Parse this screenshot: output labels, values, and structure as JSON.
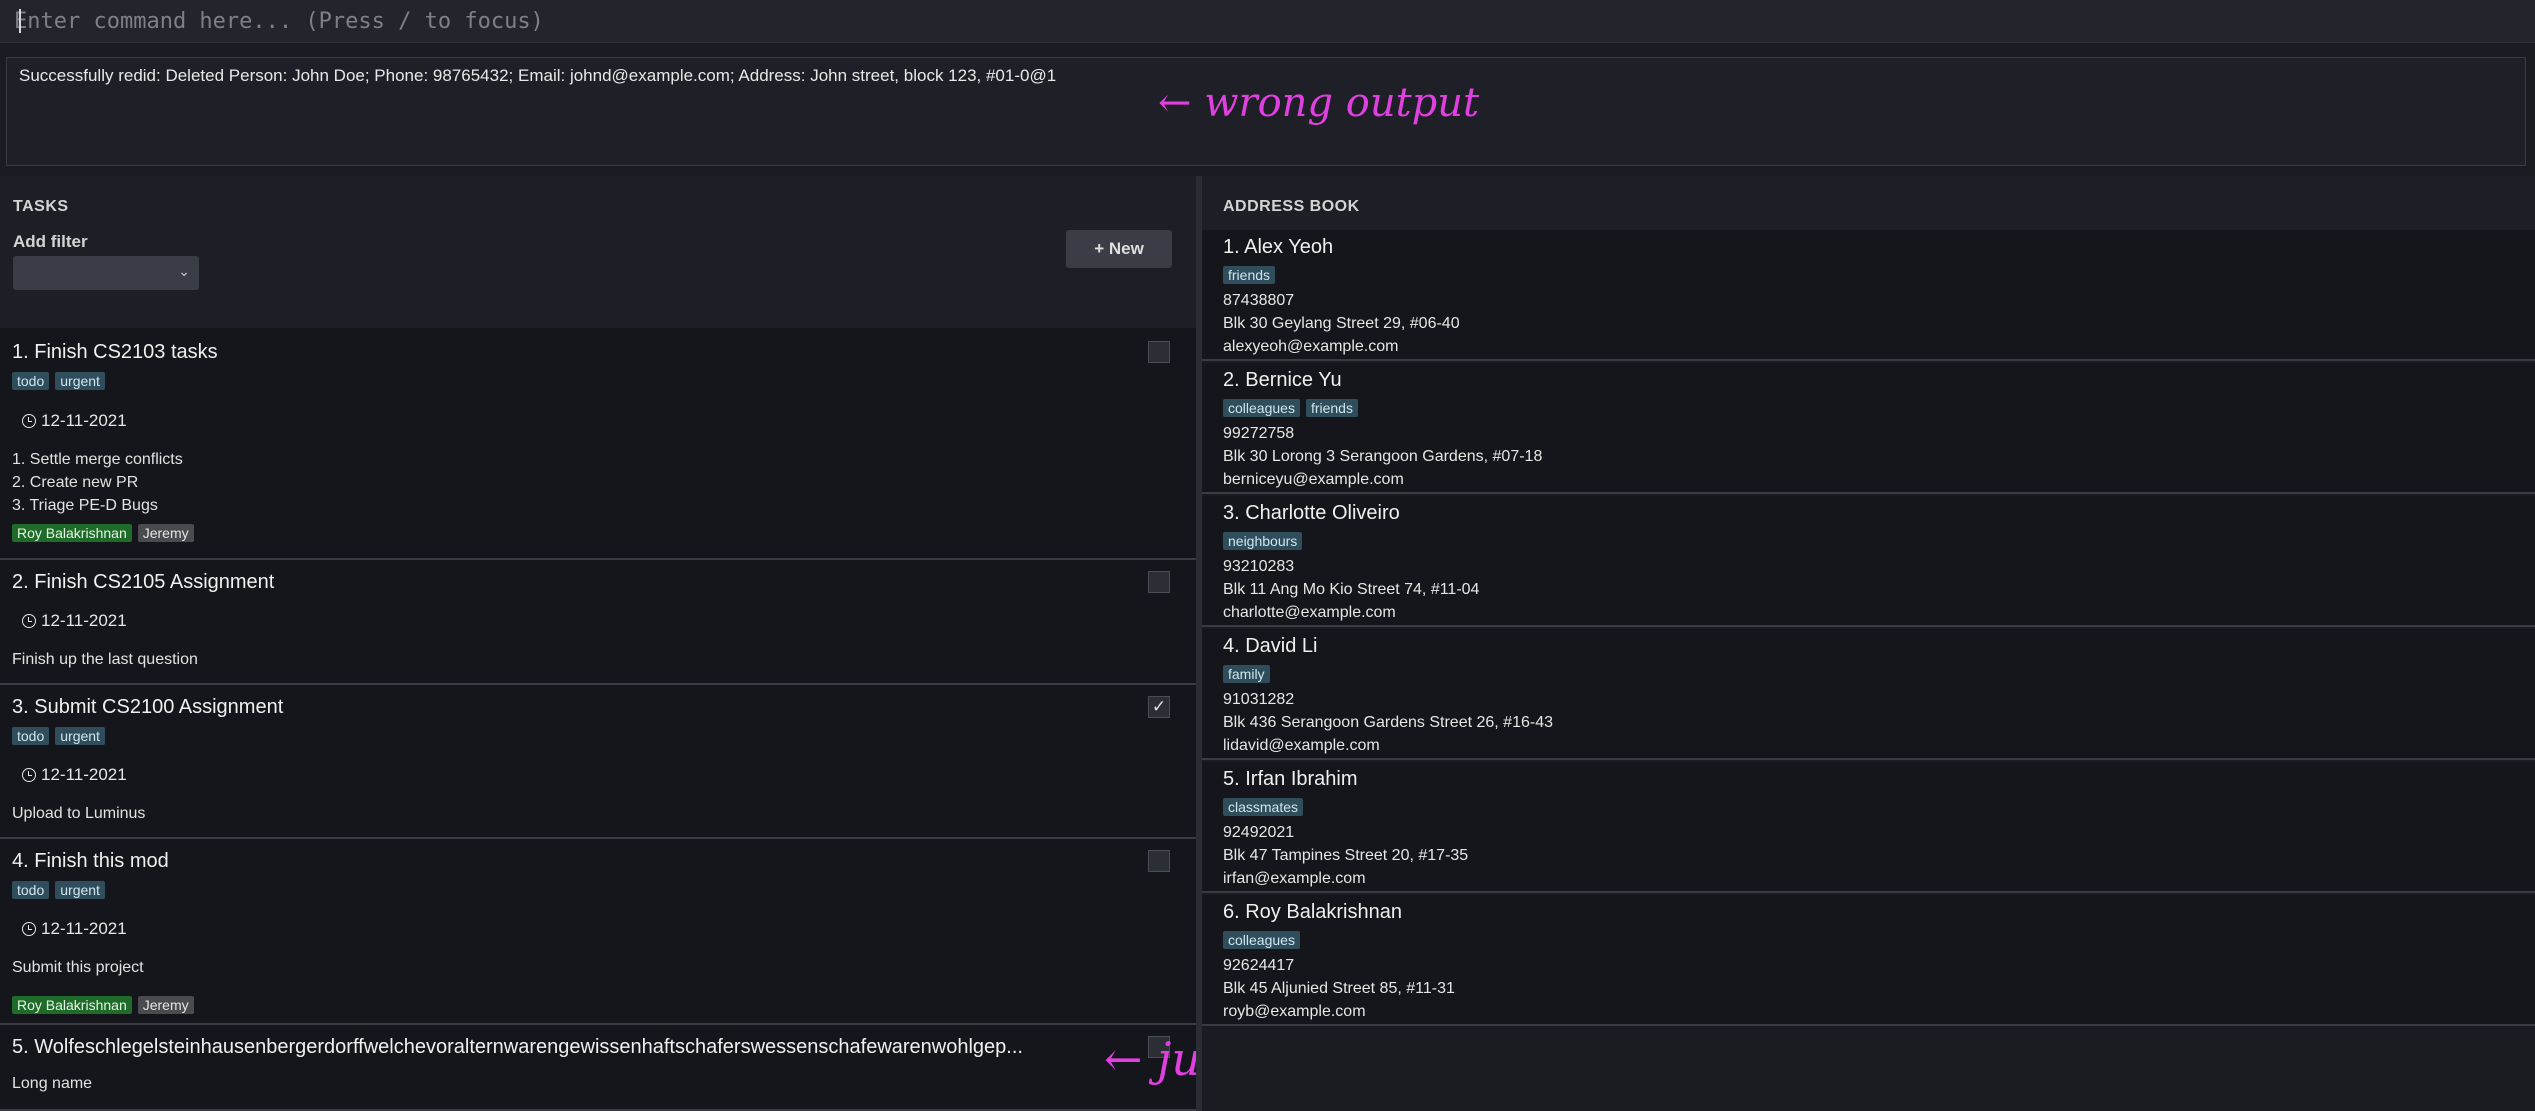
{
  "command": {
    "placeholder": "Enter command here... (Press / to focus)",
    "value": ""
  },
  "result": {
    "message": "Successfully redid: Deleted Person: John Doe; Phone: 98765432; Email: johnd@example.com; Address: John street, block 123, #01-0@1"
  },
  "annotations": {
    "wrong_output": "← wrong output",
    "just_added": "← just added",
    "color": "#e040e0"
  },
  "tasks_panel": {
    "title": "TASKS",
    "filter_label": "Add filter",
    "filter_selected": "",
    "new_button": "+ New",
    "tasks": [
      {
        "title": "1.  Finish CS2103 tasks",
        "tags": [
          "todo",
          "urgent"
        ],
        "date": "12-11-2021",
        "description": [
          "1. Settle merge conflicts",
          "2. Create new PR",
          "3. Triage PE-D Bugs"
        ],
        "people": [
          "Roy Balakrishnan",
          "Jeremy"
        ],
        "done": false
      },
      {
        "title": "2.  Finish CS2105 Assignment",
        "tags": [],
        "date": "12-11-2021",
        "description": [
          "Finish up the last question"
        ],
        "people": [],
        "done": false
      },
      {
        "title": "3.  Submit CS2100 Assignment",
        "tags": [
          "todo",
          "urgent"
        ],
        "date": "12-11-2021",
        "description": [
          "Upload to Luminus"
        ],
        "people": [],
        "done": true
      },
      {
        "title": "4.  Finish this mod",
        "tags": [
          "todo",
          "urgent"
        ],
        "date": "12-11-2021",
        "description": [
          "Submit this project"
        ],
        "people": [
          "Roy Balakrishnan",
          "Jeremy"
        ],
        "done": false
      },
      {
        "title": "5.  Wolfeschlegelsteinhausenbergerdorffwelchevoralternwarengewissenhaftschaferswessenschafewarenwohlgep...",
        "tags": [],
        "date": "",
        "description": [
          "Long name"
        ],
        "people": [],
        "done": false
      }
    ]
  },
  "address_panel": {
    "title": "ADDRESS BOOK",
    "persons": [
      {
        "name": "1.  Alex Yeoh",
        "tags": [
          "friends"
        ],
        "phone": "87438807",
        "address": "Blk 30 Geylang Street 29, #06-40",
        "email": "alexyeoh@example.com"
      },
      {
        "name": "2.  Bernice Yu",
        "tags": [
          "colleagues",
          "friends"
        ],
        "phone": "99272758",
        "address": "Blk 30 Lorong 3 Serangoon Gardens, #07-18",
        "email": "berniceyu@example.com"
      },
      {
        "name": "3.  Charlotte Oliveiro",
        "tags": [
          "neighbours"
        ],
        "phone": "93210283",
        "address": "Blk 11 Ang Mo Kio Street 74, #11-04",
        "email": "charlotte@example.com"
      },
      {
        "name": "4.  David Li",
        "tags": [
          "family"
        ],
        "phone": "91031282",
        "address": "Blk 436 Serangoon Gardens Street 26, #16-43",
        "email": "lidavid@example.com"
      },
      {
        "name": "5.  Irfan Ibrahim",
        "tags": [
          "classmates"
        ],
        "phone": "92492021",
        "address": "Blk 47 Tampines Street 20, #17-35",
        "email": "irfan@example.com"
      },
      {
        "name": "6.  Roy Balakrishnan",
        "tags": [
          "colleagues"
        ],
        "phone": "92624417",
        "address": "Blk 45 Aljunied Street 85, #11-31",
        "email": "royb@example.com"
      }
    ]
  }
}
